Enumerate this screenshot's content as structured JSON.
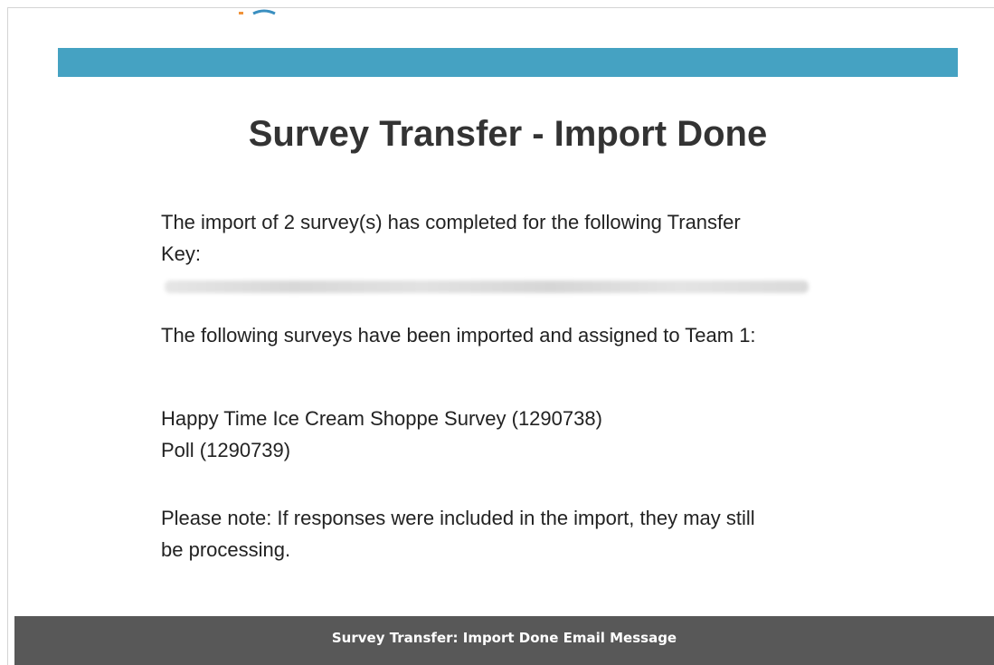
{
  "colors": {
    "header_bar": "#45a2c2",
    "footer_bg": "#585858"
  },
  "email": {
    "title": "Survey Transfer - Import Done",
    "intro_line1": "The import of 2 survey(s) has completed for the following Transfer",
    "intro_key_label": "Key:",
    "assigned_text": "The following surveys have been imported and assigned to Team 1:",
    "surveys": [
      "Happy Time Ice Cream Shoppe Survey (1290738)",
      "Poll (1290739)"
    ],
    "note_line1": "Please note: If responses were included in the import, they may still",
    "note_line2": "be processing."
  },
  "caption": {
    "text": "Survey Transfer: Import Done Email Message"
  }
}
